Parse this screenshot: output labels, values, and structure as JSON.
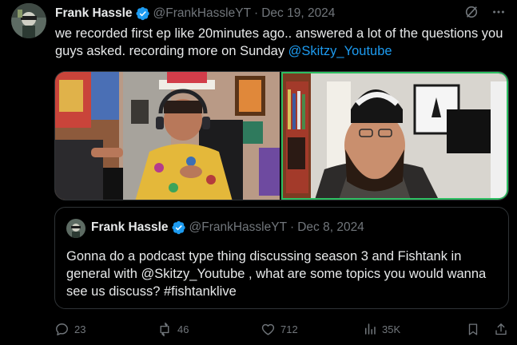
{
  "tweet": {
    "author_name": "Frank Hassle",
    "handle": "@FrankHassleYT",
    "separator": "·",
    "date": "Dec 19, 2024",
    "text": "we recorded first ep like 20minutes ago.. answered a lot of the questions you guys asked. recording more on Sunday ",
    "mention": "@Skitzy_Youtube"
  },
  "quoted_tweet": {
    "author_name": "Frank Hassle",
    "handle": "@FrankHassleYT",
    "separator": "·",
    "date": "Dec 8, 2024",
    "text": "Gonna do a podcast type thing discussing season 3 and Fishtank in general with @Skitzy_Youtube , what are some topics you would wanna see us discuss? #fishtanklive"
  },
  "actions": {
    "replies": "23",
    "reposts": "46",
    "likes": "712",
    "views": "35K"
  },
  "colors": {
    "background": "#000000",
    "text": "#e7e9ea",
    "muted": "#71767b",
    "accent": "#1d9bf0",
    "border": "#2f3336",
    "video_highlight": "#2dbf62"
  },
  "icons": [
    "grok-icon",
    "more-icon",
    "verified-icon",
    "reply-icon",
    "repost-icon",
    "like-icon",
    "views-icon",
    "bookmark-icon",
    "share-icon"
  ]
}
